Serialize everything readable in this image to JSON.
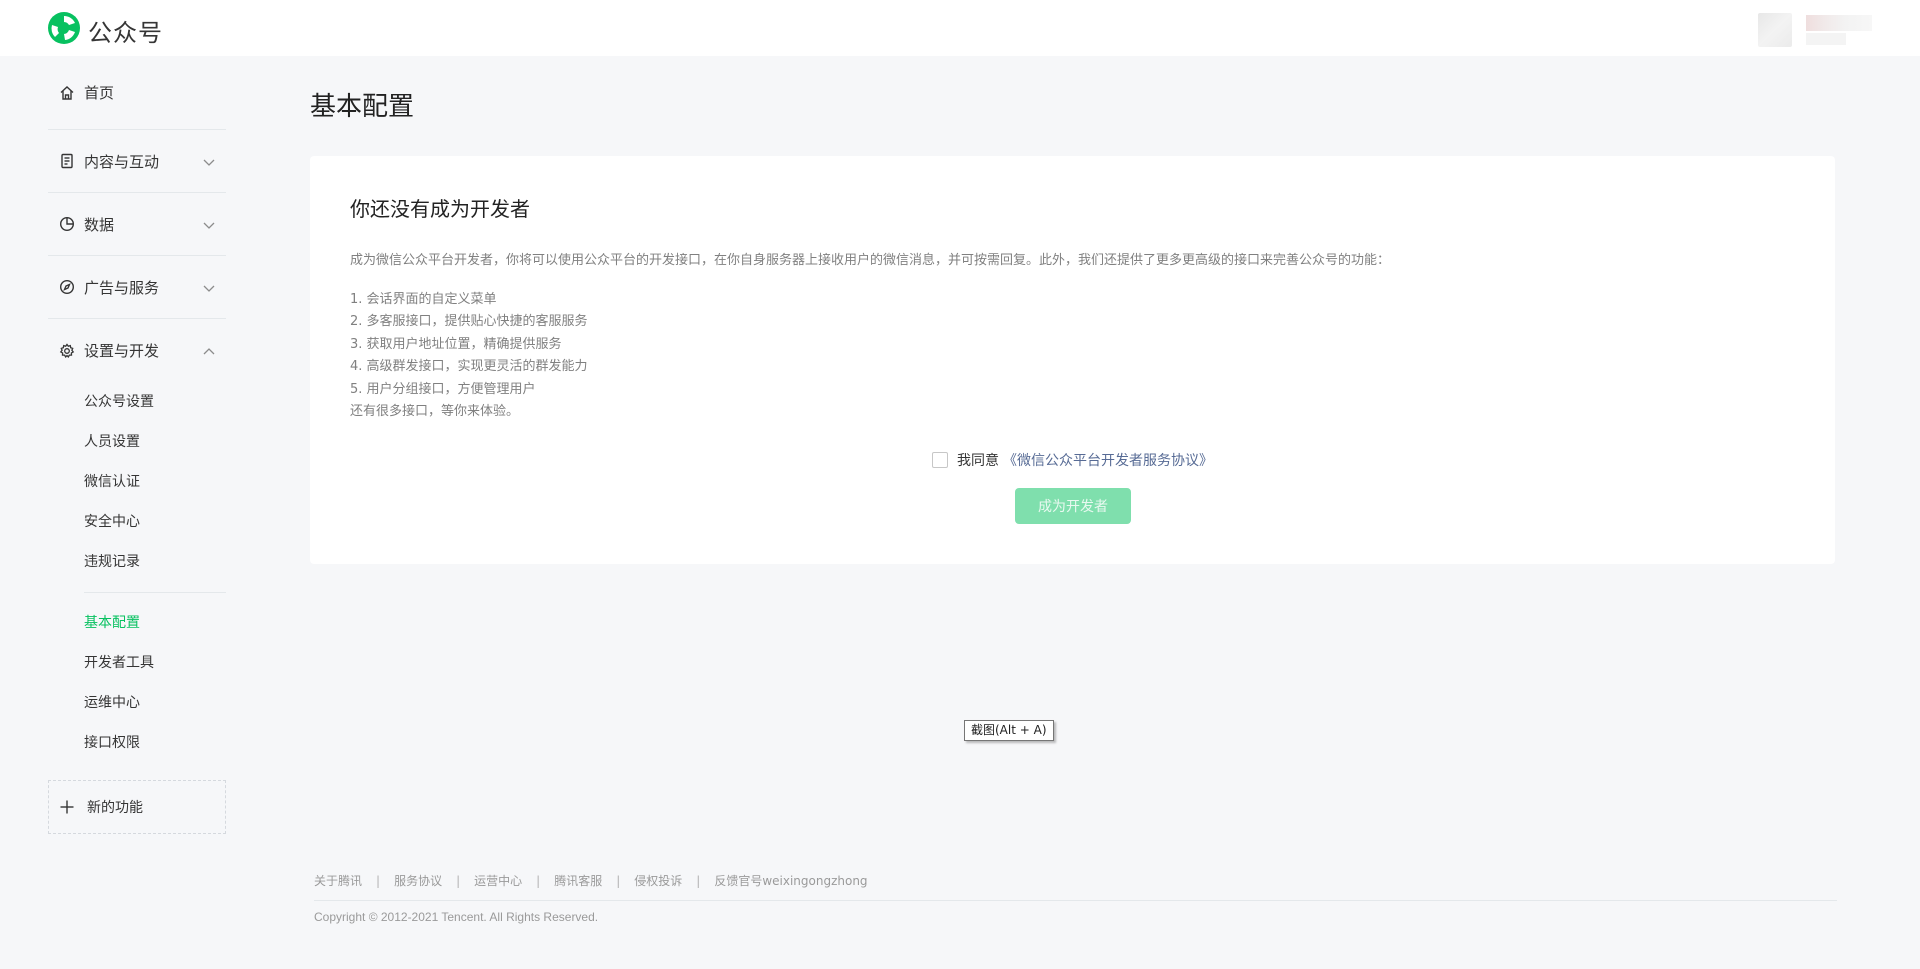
{
  "header": {
    "brand_name": "公众号"
  },
  "sidebar": {
    "home": {
      "label": "首页",
      "icon": "home-icon"
    },
    "groups": [
      {
        "label": "内容与互动",
        "icon": "document-icon",
        "expanded": false
      },
      {
        "label": "数据",
        "icon": "pie-chart-icon",
        "expanded": false
      },
      {
        "label": "广告与服务",
        "icon": "compass-icon",
        "expanded": false
      },
      {
        "label": "设置与开发",
        "icon": "gear-icon",
        "expanded": true
      }
    ],
    "settings_items": [
      "公众号设置",
      "人员设置",
      "微信认证",
      "安全中心",
      "违规记录"
    ],
    "dev_items": [
      "基本配置",
      "开发者工具",
      "运维中心",
      "接口权限"
    ],
    "active_item": "基本配置",
    "new_feature_label": "新的功能"
  },
  "main": {
    "page_title": "基本配置",
    "card": {
      "title": "你还没有成为开发者",
      "description": "成为微信公众平台开发者，你将可以使用公众平台的开发接口，在你自身服务器上接收用户的微信消息，并可按需回复。此外，我们还提供了更多更高级的接口来完善公众号的功能：",
      "features": [
        "1. 会话界面的自定义菜单",
        "2. 多客服接口，提供贴心快捷的客服服务",
        "3. 获取用户地址位置，精确提供服务",
        "4. 高级群发接口，实现更灵活的群发能力",
        "5. 用户分组接口，方便管理用户",
        "还有很多接口，等你来体验。"
      ],
      "agree_text": "我同意",
      "agreement_link": "《微信公众平台开发者服务协议》",
      "agree_checked": false,
      "button_label": "成为开发者"
    }
  },
  "tooltip": "截图(Alt + A)",
  "footer": {
    "links": [
      "关于腾讯",
      "服务协议",
      "运营中心",
      "腾讯客服",
      "侵权投诉",
      "反馈官号weixingongzhong"
    ],
    "copyright": "Copyright © 2012-2021 Tencent. All Rights Reserved."
  },
  "colors": {
    "accent": "#07c160",
    "disabled_button": "#7fdfad",
    "link": "#576b95",
    "background": "#f6f7f9"
  }
}
